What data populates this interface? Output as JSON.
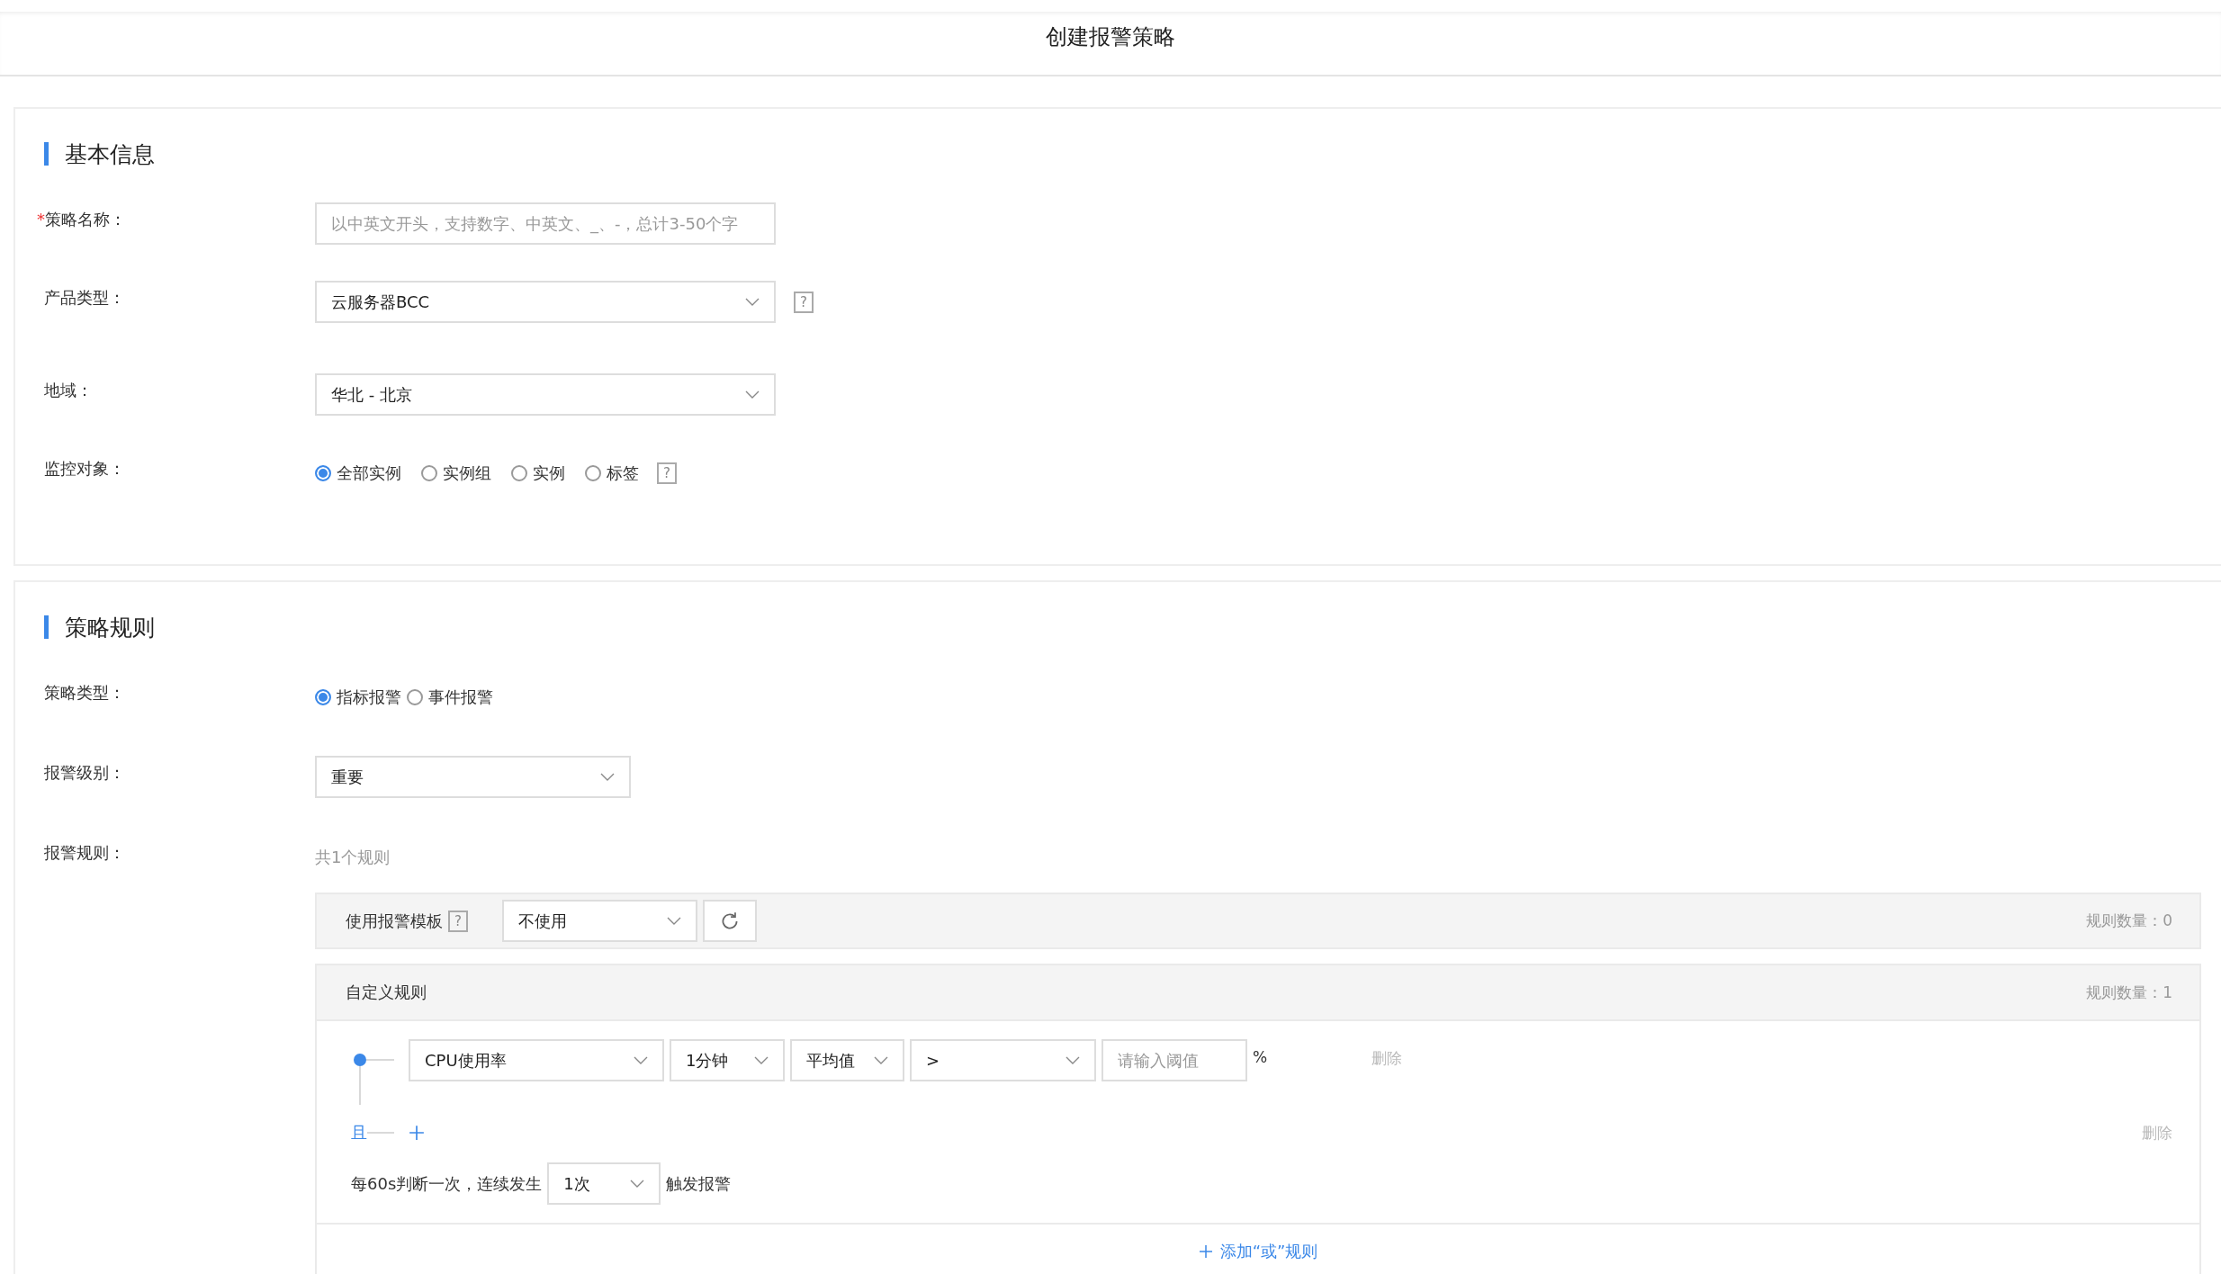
{
  "page_title": "创建报警策略",
  "basic_info": {
    "title": "基本信息",
    "fields": [
      {
        "kind": "input",
        "label": "策略名称：",
        "required_mark": "*",
        "placeholder": "以中英文开头，支持数字、中英文、_、-，总计3-50个字"
      },
      {
        "kind": "select",
        "label": "产品类型：",
        "value": "云服务器BCC",
        "help": "?"
      },
      {
        "kind": "select",
        "label": "地域：",
        "value": "华北 - 北京"
      },
      {
        "kind": "radio",
        "label": "监控对象：",
        "options": [
          {
            "label": "全部实例",
            "selected": true
          },
          {
            "label": "实例组",
            "selected": false
          },
          {
            "label": "实例",
            "selected": false
          },
          {
            "label": "标签",
            "selected": false
          }
        ],
        "help": "?"
      }
    ]
  },
  "policy_rules": {
    "title": "策略规则",
    "fields": [
      {
        "kind": "radio",
        "label": "策略类型：",
        "options": [
          {
            "label": "指标报警",
            "selected": true
          },
          {
            "label": "事件报警",
            "selected": false
          }
        ]
      },
      {
        "kind": "select",
        "label": "报警级别：",
        "value": "重要"
      },
      {
        "kind": "note",
        "label": "报警规则：",
        "value": "共1个规则"
      }
    ],
    "template": {
      "label": "使用报警模板",
      "help": "?",
      "value": "不使用",
      "count": "规则数量：0"
    },
    "custom": {
      "title": "自定义规则",
      "count": "规则数量：1",
      "condition": {
        "metric": "CPU使用率",
        "period": "1分钟",
        "statistic": "平均值",
        "operator": ">",
        "threshold_placeholder": "请输入阈值",
        "unit": "%",
        "delete": "删除"
      },
      "and_label": "且",
      "group_delete": "删除",
      "frequency": {
        "prefix": "每60s判断一次，连续发生",
        "value": "1次",
        "suffix": "触发报警"
      }
    },
    "add_or": "添加“或”规则"
  }
}
